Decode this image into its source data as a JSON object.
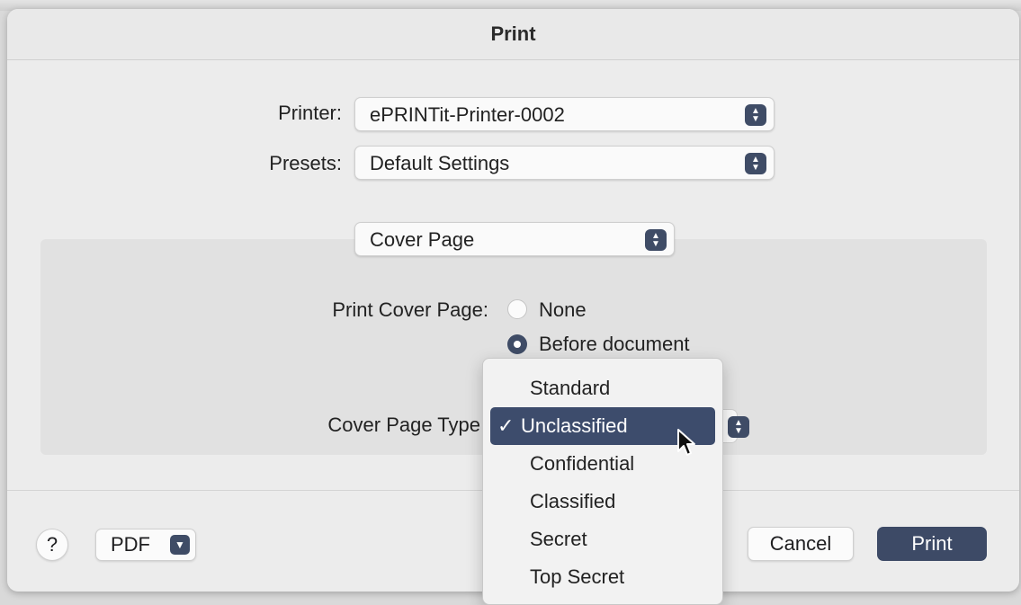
{
  "dialog": {
    "title": "Print"
  },
  "printer": {
    "label": "Printer:",
    "value": "ePRINTit-Printer-0002"
  },
  "presets": {
    "label": "Presets:",
    "value": "Default Settings"
  },
  "section_popup": {
    "value": "Cover Page"
  },
  "cover_page": {
    "label": "Print Cover Page:",
    "options": [
      {
        "label": "None",
        "selected": false
      },
      {
        "label": "Before document",
        "selected": true
      }
    ]
  },
  "cover_page_type": {
    "label": "Cover Page Type",
    "menu": [
      {
        "label": "Standard",
        "selected": false
      },
      {
        "label": "Unclassified",
        "selected": true
      },
      {
        "label": "Confidential",
        "selected": false
      },
      {
        "label": "Classified",
        "selected": false
      },
      {
        "label": "Secret",
        "selected": false
      },
      {
        "label": "Top Secret",
        "selected": false
      }
    ],
    "check_mark": "✓"
  },
  "footer": {
    "help_label": "?",
    "pdf_label": "PDF",
    "cancel_label": "Cancel",
    "print_label": "Print"
  },
  "colors": {
    "accent": "#3d4a66",
    "dialog_bg": "#ececec",
    "panel_bg": "#e1e1e1"
  }
}
